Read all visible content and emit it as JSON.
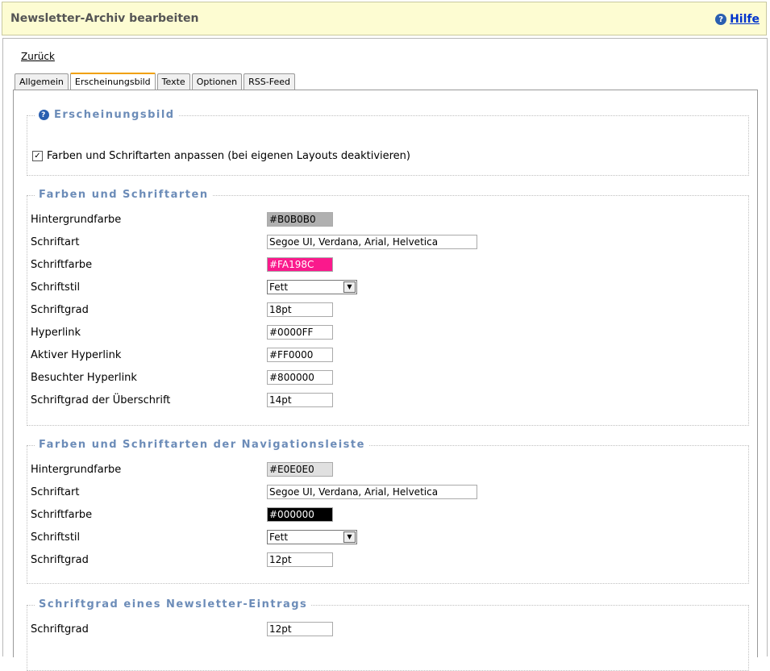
{
  "header": {
    "title": "Newsletter-Archiv bearbeiten",
    "help_label": "Hilfe"
  },
  "nav": {
    "back_label": "Zurück"
  },
  "tabs": [
    "Allgemein",
    "Erscheinungsbild",
    "Texte",
    "Optionen",
    "RSS-Feed"
  ],
  "active_tab": "Erscheinungsbild",
  "section_appearance": {
    "legend": "Erscheinungsbild",
    "checkbox_label": "Farben und Schriftarten anpassen (bei eigenen Layouts deaktivieren)",
    "checked": true
  },
  "section_colors": {
    "legend": "Farben und Schriftarten",
    "fields": {
      "bg_label": "Hintergrundfarbe",
      "bg_value": "#B0B0B0",
      "bg_color": "#B0B0B0",
      "font_label": "Schriftart",
      "font_value": "Segoe UI, Verdana, Arial, Helvetica",
      "fontcolor_label": "Schriftfarbe",
      "fontcolor_value": "#FA198C",
      "fontcolor_color": "#FA198C",
      "style_label": "Schriftstil",
      "style_value": "Fett",
      "size_label": "Schriftgrad",
      "size_value": "18pt",
      "link_label": "Hyperlink",
      "link_value": "#0000FF",
      "active_label": "Aktiver Hyperlink",
      "active_value": "#FF0000",
      "visited_label": "Besuchter Hyperlink",
      "visited_value": "#800000",
      "heading_label": "Schriftgrad der Überschrift",
      "heading_value": "14pt"
    }
  },
  "section_nav": {
    "legend": "Farben und Schriftarten der Navigationsleiste",
    "fields": {
      "bg_label": "Hintergrundfarbe",
      "bg_value": "#E0E0E0",
      "bg_color": "#E0E0E0",
      "font_label": "Schriftart",
      "font_value": "Segoe UI, Verdana, Arial, Helvetica",
      "fontcolor_label": "Schriftfarbe",
      "fontcolor_value": "#000000",
      "fontcolor_color": "#000000",
      "style_label": "Schriftstil",
      "style_value": "Fett",
      "size_label": "Schriftgrad",
      "size_value": "12pt"
    }
  },
  "section_entry": {
    "legend": "Schriftgrad eines Newsletter-Eintrags",
    "fields": {
      "size_label": "Schriftgrad",
      "size_value": "12pt"
    }
  }
}
